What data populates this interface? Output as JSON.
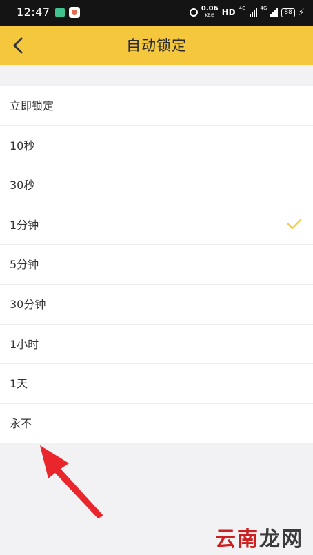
{
  "status_bar": {
    "time": "12:47",
    "speed_value": "0.06",
    "speed_unit": "KB/S",
    "hd_label": "HD",
    "network_label": "4G",
    "battery": "88"
  },
  "header": {
    "title": "自动锁定",
    "back_icon": "chevron-left-icon",
    "background_color": "#f5c73c"
  },
  "options": [
    {
      "label": "立即锁定",
      "selected": false
    },
    {
      "label": "10秒",
      "selected": false
    },
    {
      "label": "30秒",
      "selected": false
    },
    {
      "label": "1分钟",
      "selected": true
    },
    {
      "label": "5分钟",
      "selected": false
    },
    {
      "label": "30分钟",
      "selected": false
    },
    {
      "label": "1小时",
      "selected": false
    },
    {
      "label": "1天",
      "selected": false
    },
    {
      "label": "永不",
      "selected": false
    }
  ],
  "check_icon": "checkmark-icon",
  "check_color": "#f5c73c",
  "annotation_arrow_color": "#e8262b",
  "watermark": {
    "brand_a": "云南",
    "brand_b": "龙网"
  }
}
